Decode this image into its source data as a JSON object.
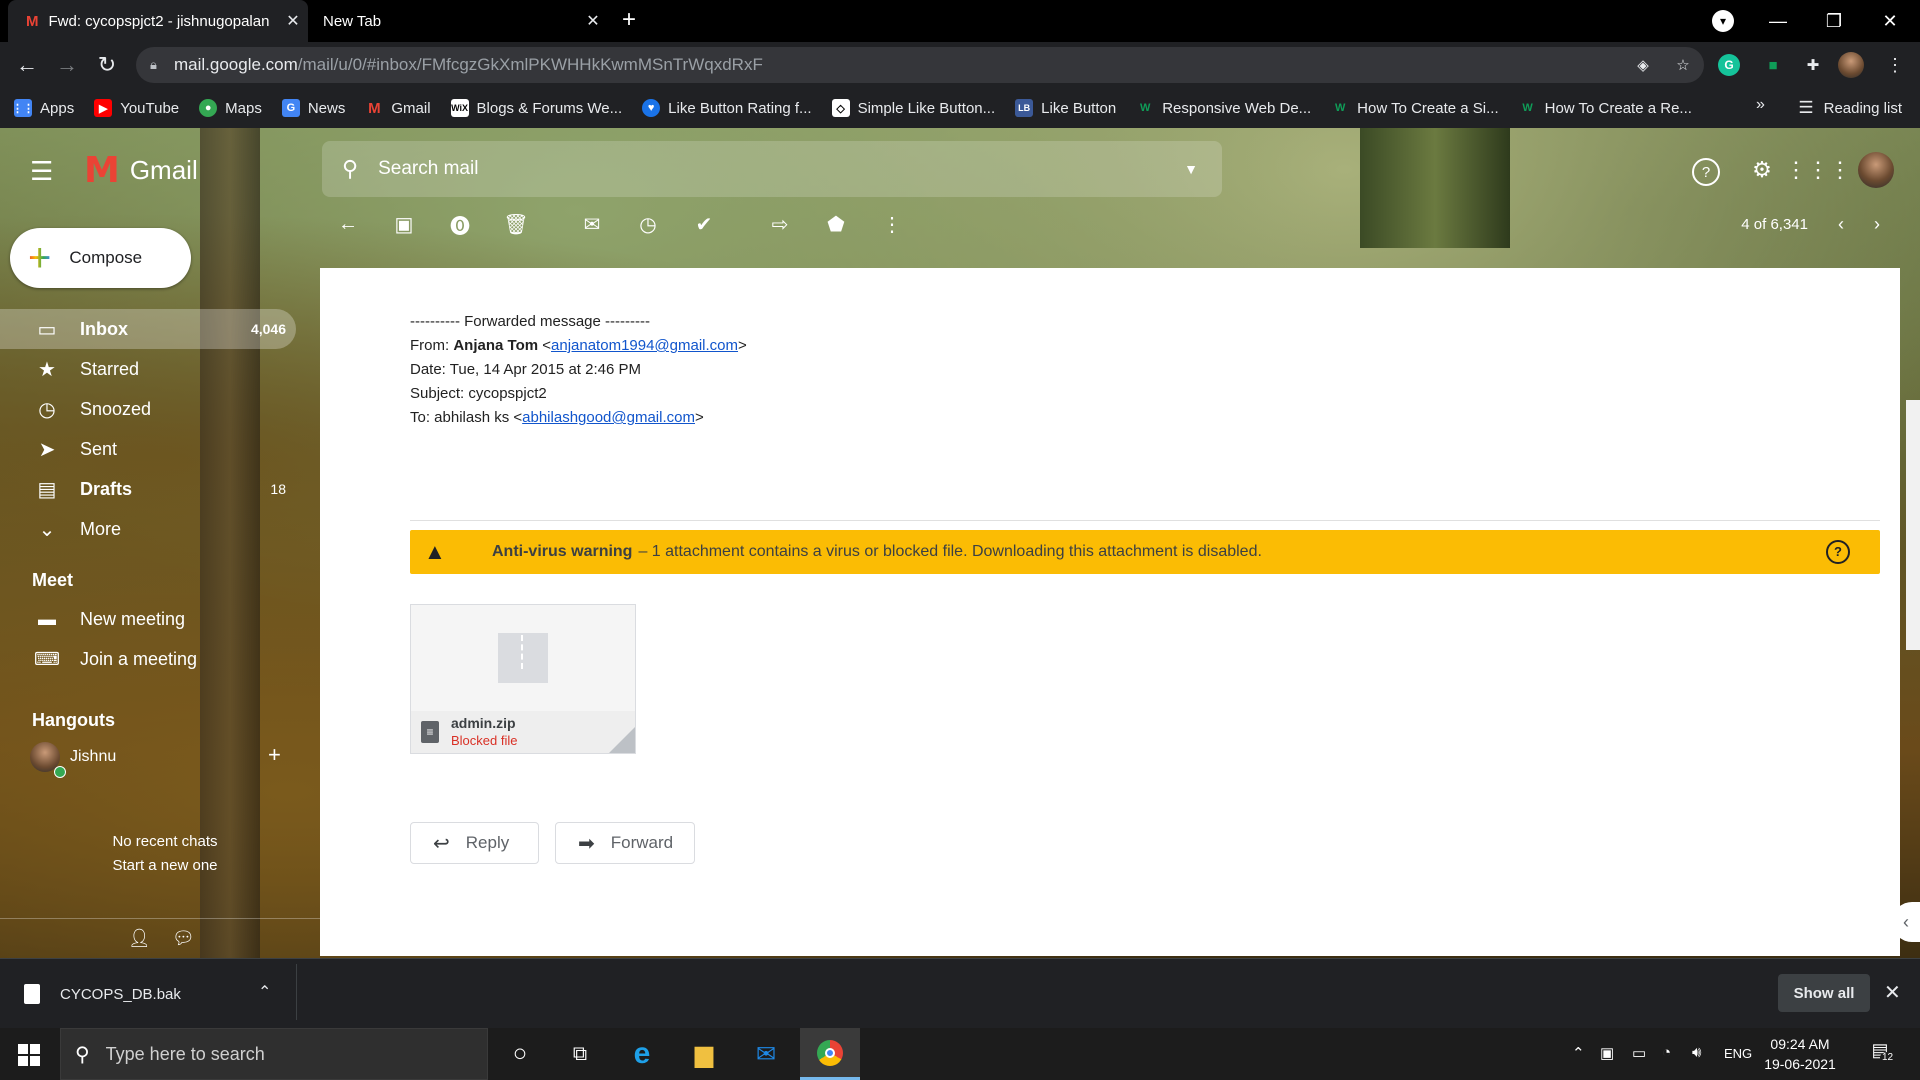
{
  "browser": {
    "tabs": [
      {
        "title": "Fwd: cycopspjct2 - jishnugopalan"
      },
      {
        "title": "New Tab"
      }
    ],
    "url_host": "mail.google.com",
    "url_path": "/mail/u/0/#inbox/FMfcgzGkXmlPKWHHkKwmMSnTrWqxdRxF",
    "bookmarks": [
      {
        "label": "Apps",
        "color": "#4285f4",
        "glyph": "⋮⋮"
      },
      {
        "label": "YouTube",
        "color": "#ff0000",
        "glyph": "▶"
      },
      {
        "label": "Maps",
        "color": "#34a853",
        "glyph": "●"
      },
      {
        "label": "News",
        "color": "#4285f4",
        "glyph": "G"
      },
      {
        "label": "Gmail",
        "color": "#ea4335",
        "glyph": "M"
      },
      {
        "label": "Blogs & Forums We...",
        "color": "#ffffff",
        "glyph": "W"
      },
      {
        "label": "Like Button Rating f...",
        "color": "#1a73e8",
        "glyph": "♥"
      },
      {
        "label": "Simple Like Button...",
        "color": "#ffffff",
        "glyph": "◇"
      },
      {
        "label": "Like Button",
        "color": "#3b5998",
        "glyph": "LB"
      },
      {
        "label": "Responsive Web De...",
        "color": "#0f9d58",
        "glyph": "W"
      },
      {
        "label": "How To Create a Si...",
        "color": "#0f9d58",
        "glyph": "W"
      },
      {
        "label": "How To Create a Re...",
        "color": "#0f9d58",
        "glyph": "W"
      }
    ],
    "reading_list": "Reading list",
    "more_bookmarks": "»"
  },
  "gmail": {
    "logo_text": "Gmail",
    "search_placeholder": "Search mail",
    "compose": "Compose",
    "nav": [
      {
        "label": "Inbox",
        "count": "4,046",
        "icon": "inbox-icon",
        "glyph": "▭",
        "bold": true
      },
      {
        "label": "Starred",
        "count": "",
        "icon": "star-icon",
        "glyph": "★"
      },
      {
        "label": "Snoozed",
        "count": "",
        "icon": "clock-icon",
        "glyph": "◷"
      },
      {
        "label": "Sent",
        "count": "",
        "icon": "send-icon",
        "glyph": "➤"
      },
      {
        "label": "Drafts",
        "count": "18",
        "icon": "draft-icon",
        "glyph": "▤",
        "bold": true
      },
      {
        "label": "More",
        "count": "",
        "icon": "chevron-down-icon",
        "glyph": "⌄"
      }
    ],
    "meet": {
      "title": "Meet",
      "new_meeting": "New meeting",
      "join_meeting": "Join a meeting"
    },
    "hangouts": {
      "title": "Hangouts",
      "user": "Jishnu",
      "no_recent": "No recent chats",
      "start_new": "Start a new one"
    },
    "pager": "4 of 6,341"
  },
  "message": {
    "forwarded_header": "---------- Forwarded message ---------",
    "from_label": "From: ",
    "from_name": "Anjana Tom",
    "from_email": "anjanatom1994@gmail.com",
    "date": "Date: Tue, 14 Apr 2015 at 2:46 PM",
    "subject": "Subject: cycopspjct2",
    "to_label": "To: abhilash ks <",
    "to_email": "abhilashgood@gmail.com",
    "warning_title": "Anti-virus warning",
    "warning_text": "– 1 attachment contains a virus or blocked file. Downloading this attachment is disabled.",
    "attachment_name": "admin.zip",
    "attachment_status": "Blocked file",
    "reply": "Reply",
    "forward": "Forward"
  },
  "downloads": {
    "file": "CYCOPS_DB.bak",
    "show_all": "Show all"
  },
  "taskbar": {
    "search_placeholder": "Type here to search",
    "lang": "ENG",
    "time": "09:24 AM",
    "date": "19-06-2021",
    "notifications": "12"
  }
}
